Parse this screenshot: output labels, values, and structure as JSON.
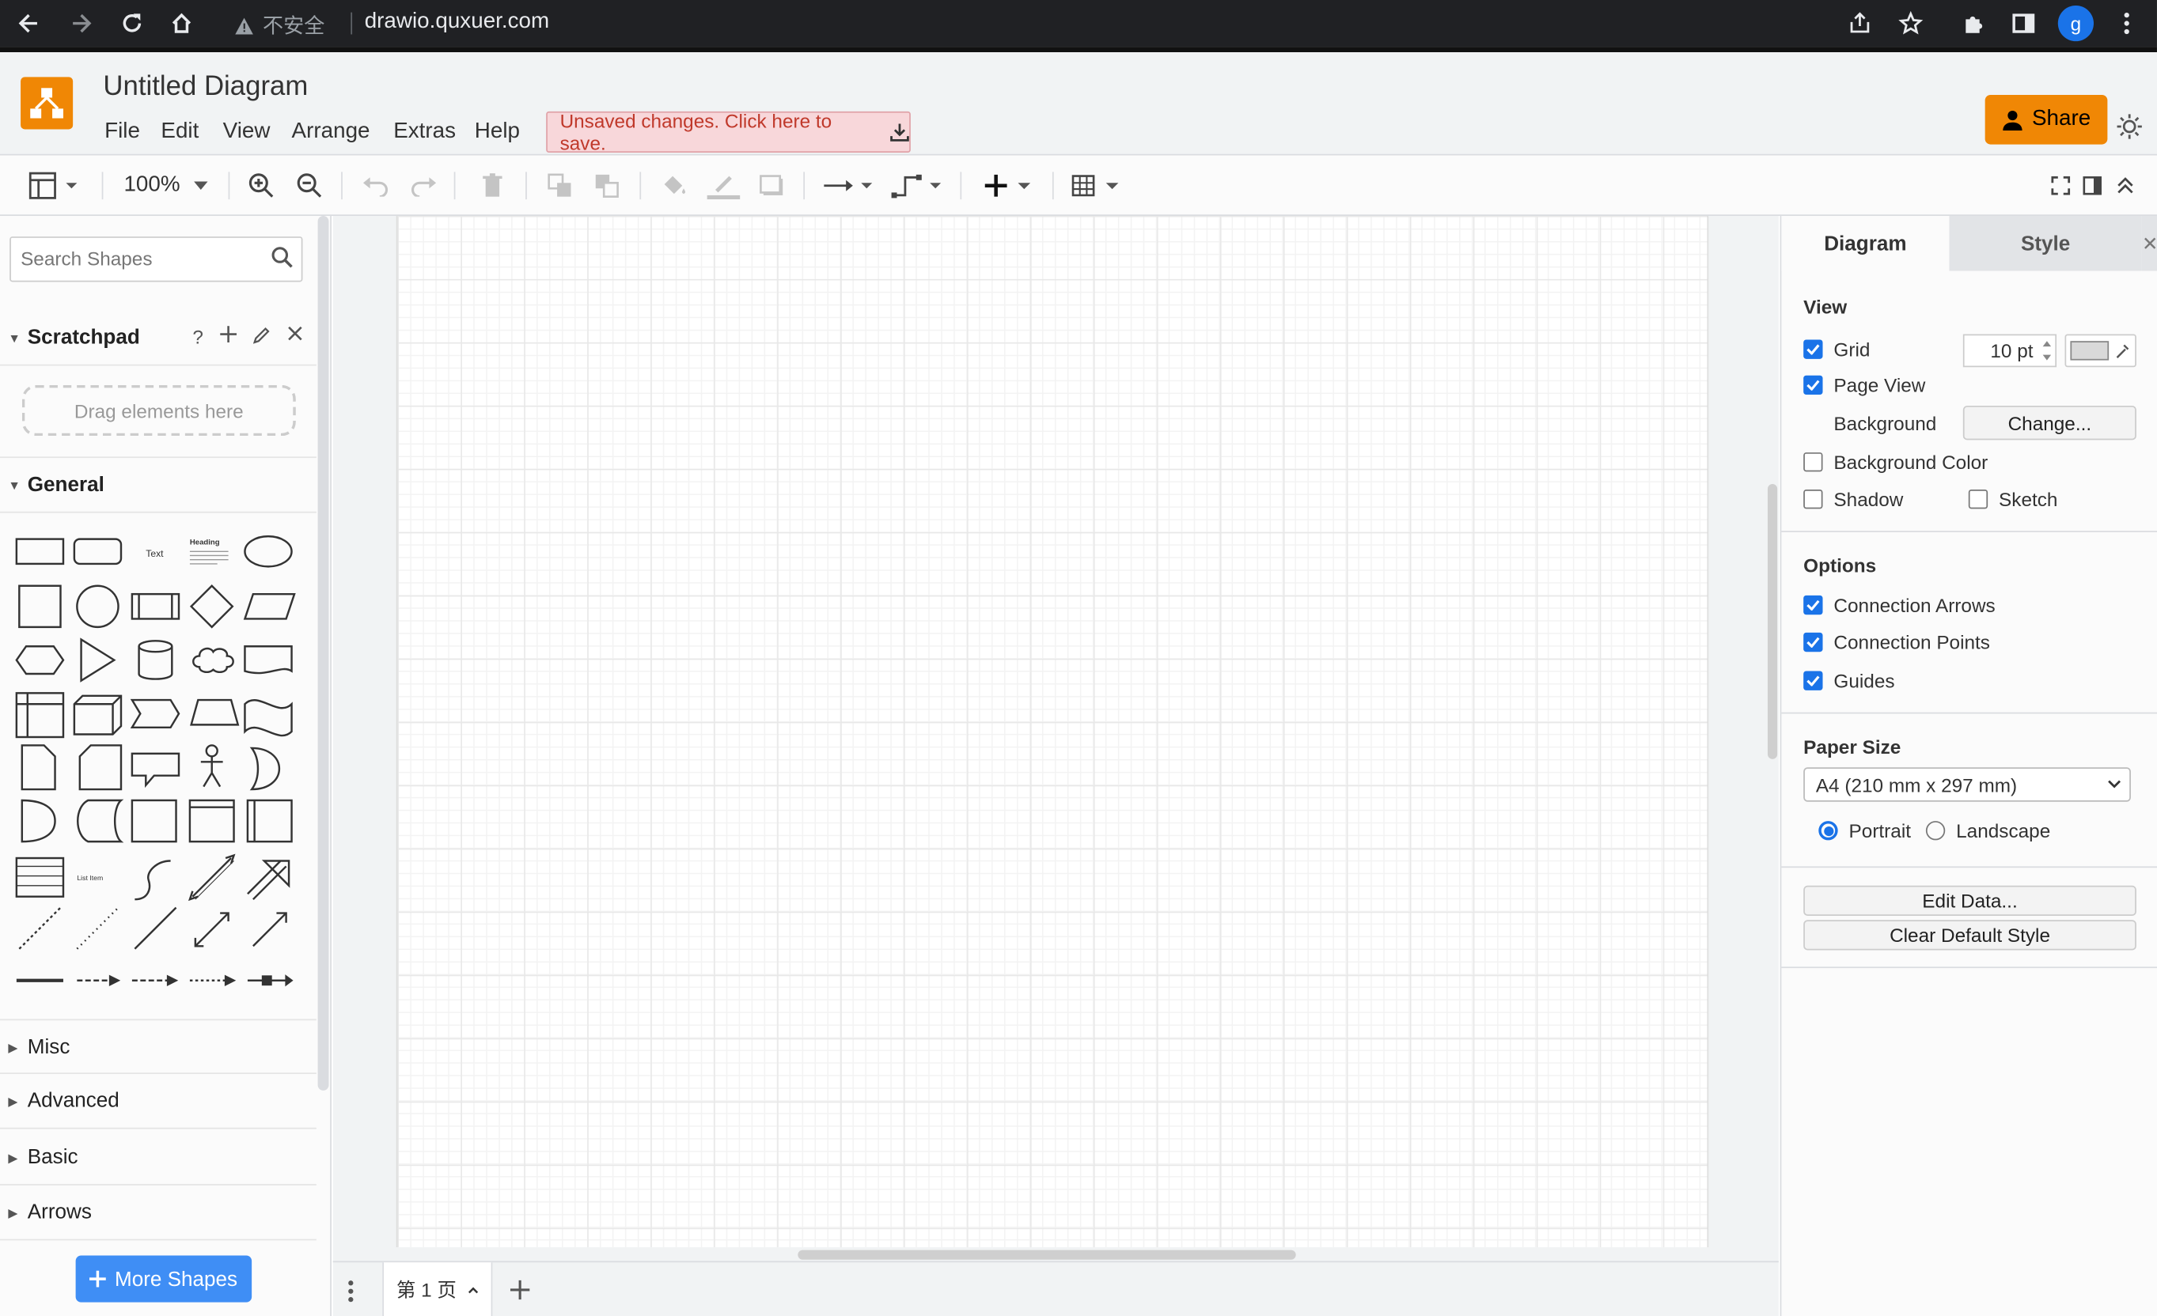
{
  "browser": {
    "security_label": "不安全",
    "url": "drawio.quxuer.com",
    "profile_initial": "g"
  },
  "app": {
    "title": "Untitled Diagram",
    "menu": [
      "File",
      "Edit",
      "View",
      "Arrange",
      "Extras",
      "Help"
    ],
    "unsaved_notice": "Unsaved changes. Click here to save.",
    "share_label": "Share",
    "brand_color": "#f08705"
  },
  "toolbar": {
    "zoom": "100%"
  },
  "sidebar": {
    "search_placeholder": "Search Shapes",
    "scratchpad": {
      "title": "Scratchpad",
      "help": "?",
      "dropzone": "Drag elements here"
    },
    "general_title": "General",
    "shape_labels": {
      "text": "Text",
      "heading": "Heading",
      "list_item": "List Item"
    },
    "collapsed_sections": [
      "Misc",
      "Advanced",
      "Basic",
      "Arrows"
    ],
    "more_shapes": "More Shapes"
  },
  "pages": {
    "current": "第 1 页"
  },
  "panel": {
    "tabs": [
      "Diagram",
      "Style"
    ],
    "view": {
      "title": "View",
      "grid_label": "Grid",
      "grid_checked": true,
      "grid_size": "10 pt",
      "page_view_label": "Page View",
      "page_view_checked": true,
      "background_label": "Background",
      "change_button": "Change...",
      "background_color_label": "Background Color",
      "background_color_checked": false,
      "shadow_label": "Shadow",
      "shadow_checked": false,
      "sketch_label": "Sketch",
      "sketch_checked": false
    },
    "options": {
      "title": "Options",
      "connection_arrows": "Connection Arrows",
      "connection_points": "Connection Points",
      "guides": "Guides"
    },
    "paper": {
      "title": "Paper Size",
      "size": "A4 (210 mm x 297 mm)",
      "portrait": "Portrait",
      "landscape": "Landscape",
      "orientation": "Portrait"
    },
    "edit_data": "Edit Data...",
    "clear_default_style": "Clear Default Style"
  }
}
